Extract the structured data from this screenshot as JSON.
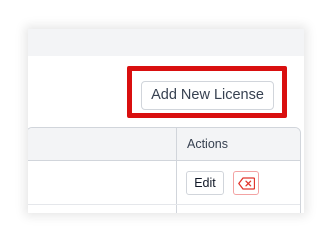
{
  "toolbar": {
    "add_license_label": "Add New License"
  },
  "table": {
    "columns": [
      "",
      "Actions"
    ],
    "rows": [
      {
        "actions": {
          "edit_label": "Edit",
          "delete_icon": "backspace-x-icon"
        }
      }
    ]
  },
  "colors": {
    "highlight": "#d90f0f",
    "delete_accent": "#e0362d",
    "header_background": "#f3f4f6"
  }
}
